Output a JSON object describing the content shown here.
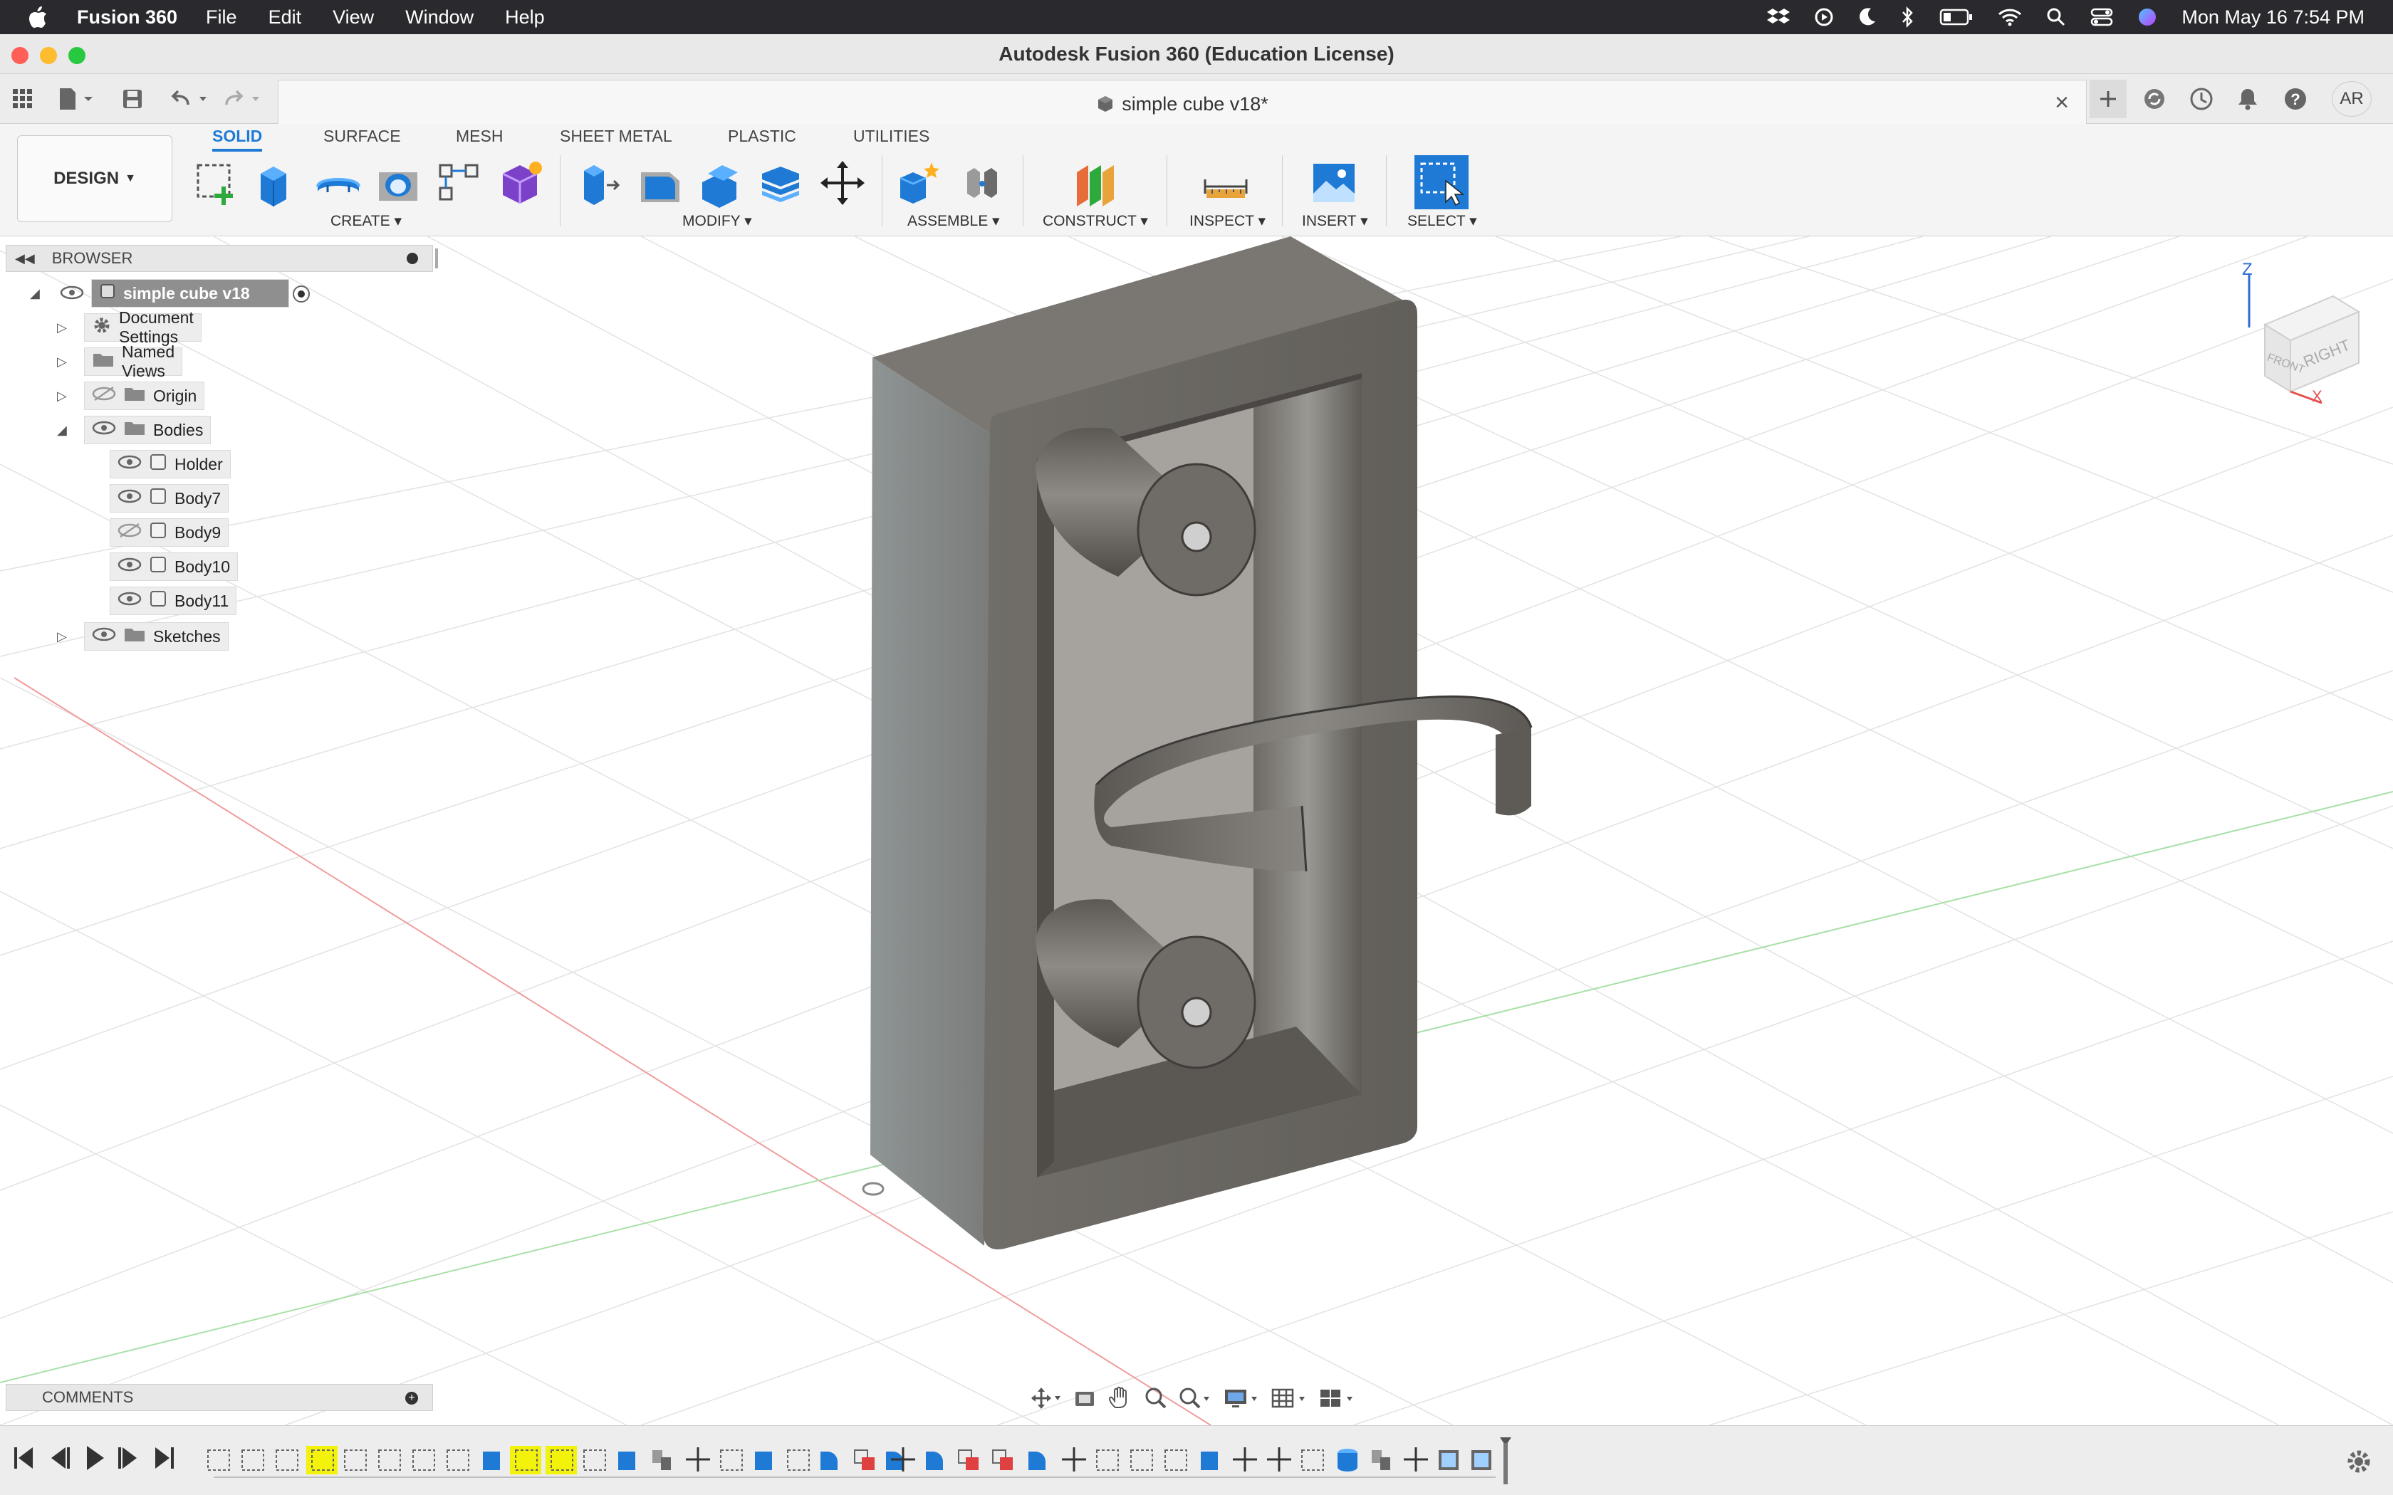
{
  "menubar": {
    "app_name": "Fusion 360",
    "items": [
      "File",
      "Edit",
      "View",
      "Window",
      "Help"
    ],
    "datetime": "Mon May 16  7:54 PM"
  },
  "window": {
    "title": "Autodesk Fusion 360 (Education License)"
  },
  "tabbar": {
    "doc_tab": "simple cube v18*",
    "user_initials": "AR"
  },
  "toolbar": {
    "workspace": "DESIGN",
    "tabs": [
      "SOLID",
      "SURFACE",
      "MESH",
      "SHEET METAL",
      "PLASTIC",
      "UTILITIES"
    ],
    "groups": [
      "CREATE",
      "MODIFY",
      "ASSEMBLE",
      "CONSTRUCT",
      "INSPECT",
      "INSERT",
      "SELECT"
    ]
  },
  "browser": {
    "title": "BROWSER",
    "root": "simple cube v18",
    "items": [
      "Document Settings",
      "Named Views",
      "Origin",
      "Bodies",
      "Sketches"
    ],
    "bodies": [
      "Holder",
      "Body7",
      "Body9",
      "Body10",
      "Body11"
    ]
  },
  "comments": {
    "title": "COMMENTS"
  },
  "viewcube": {
    "z": "Z",
    "x": "X",
    "front": "FRONT",
    "right": "RIGHT"
  },
  "colors": {
    "accent": "#1f7ad6",
    "model": "#6e6b66",
    "timeline_highlight": "#f2f20a"
  }
}
